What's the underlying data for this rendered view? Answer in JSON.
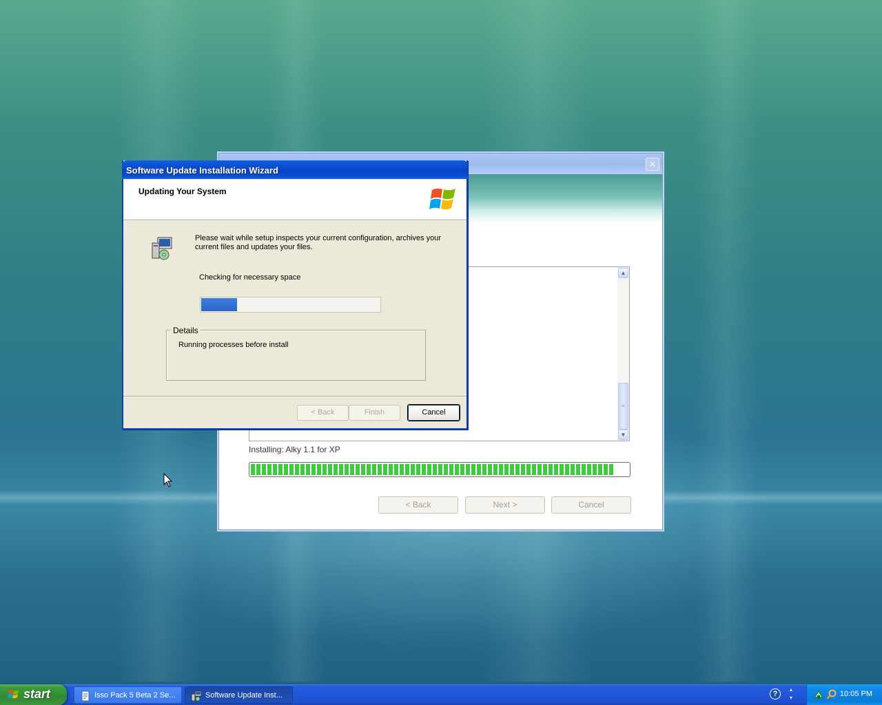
{
  "back_window": {
    "status_text": "Installing: Alky 1.1 for XP",
    "progress_fraction": 0.96,
    "buttons": {
      "back": "< Back",
      "next": "Next >",
      "cancel": "Cancel"
    },
    "close_glyph": "✕"
  },
  "wizard": {
    "title": "Software Update Installation Wizard",
    "header_title": "Updating Your System",
    "description": "Please wait while setup inspects your current configuration, archives your current files and updates your files.",
    "status": "Checking for necessary space",
    "progress_fraction": 0.2,
    "details_label": "Details",
    "details_text": "Running processes before install",
    "buttons": {
      "back": "< Back",
      "finish": "Finish",
      "cancel": "Cancel"
    }
  },
  "taskbar": {
    "start_label": "start",
    "tasks": [
      {
        "label": "Isso Pack 5 Beta 2 Se...",
        "icon": "document-icon",
        "active": false
      },
      {
        "label": "Software Update Inst...",
        "icon": "setup-icon",
        "active": true
      }
    ],
    "clock": "10:05 PM",
    "help_glyph": "?"
  },
  "colors": {
    "accent_blue": "#0a4dcf",
    "progress_blue": "#2c63c8",
    "progress_green": "#3ecb3e",
    "start_green": "#318b31"
  }
}
